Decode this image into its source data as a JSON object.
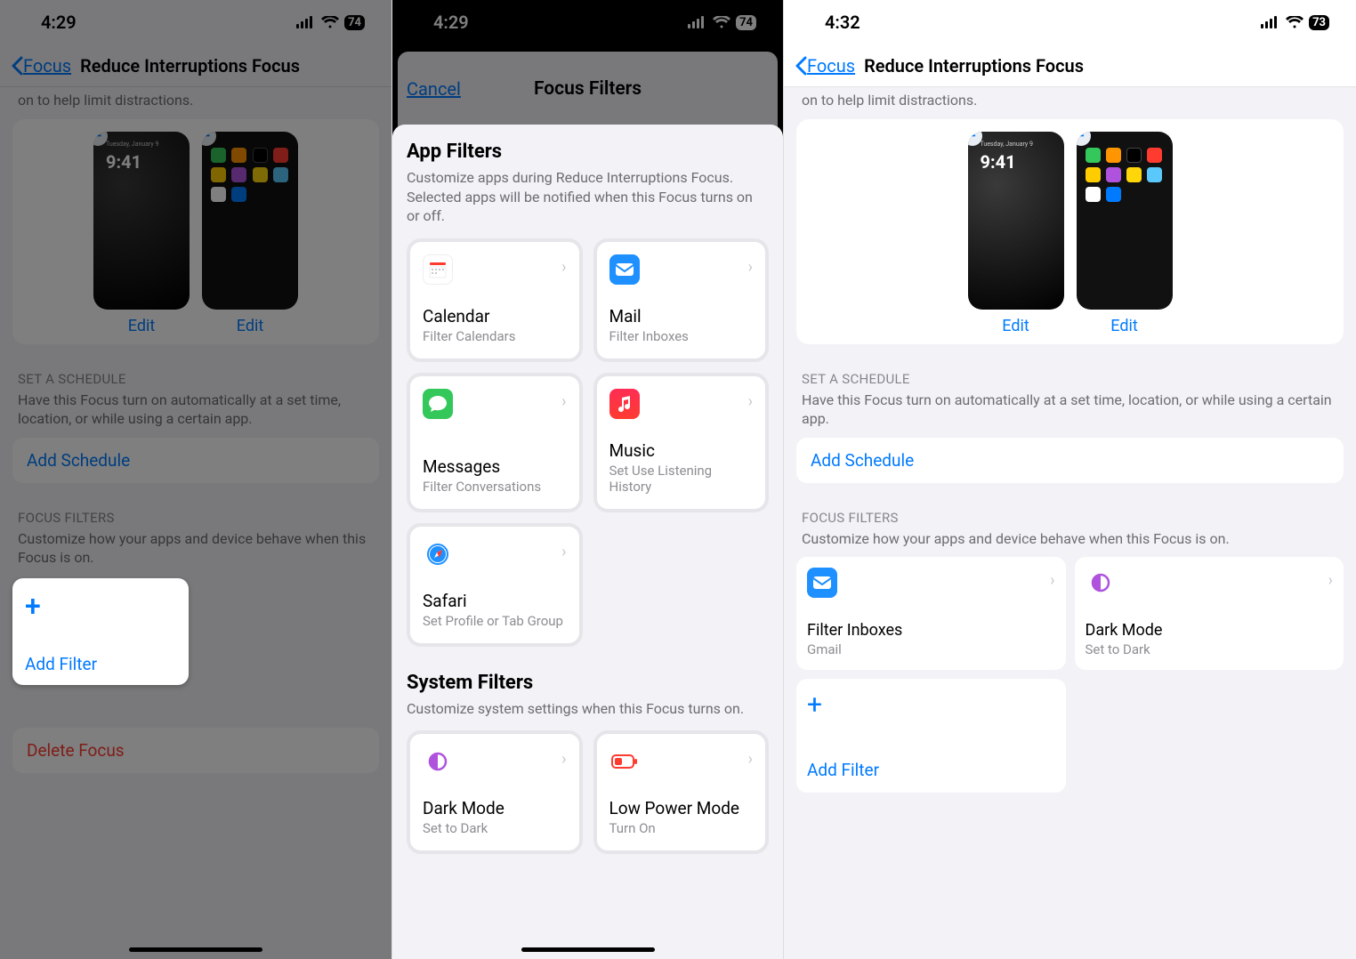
{
  "col1": {
    "status": {
      "time": "4:29",
      "battery": "74"
    },
    "nav": {
      "back": "Focus",
      "title": "Reduce Interruptions Focus"
    },
    "intro_tail": "on to help limit distractions.",
    "preview": {
      "lock_time": "9:41",
      "lock_date": "Tuesday, January 9",
      "edit": "Edit"
    },
    "schedule": {
      "title": "SET A SCHEDULE",
      "desc": "Have this Focus turn on automatically at a set time, location, or while using a certain app.",
      "button": "Add Schedule"
    },
    "filters": {
      "title": "FOCUS FILTERS",
      "desc": "Customize how your apps and device behave when this Focus is on.",
      "add": "Add Filter"
    },
    "delete": "Delete Focus"
  },
  "col2": {
    "status": {
      "time": "4:29",
      "battery": "74"
    },
    "nav": {
      "cancel": "Cancel",
      "title": "Focus Filters"
    },
    "app": {
      "title": "App Filters",
      "desc": "Customize apps during Reduce Interruptions Focus. Selected apps will be notified when this Focus turns on or off.",
      "items": [
        {
          "title": "Calendar",
          "sub": "Filter Calendars"
        },
        {
          "title": "Mail",
          "sub": "Filter Inboxes"
        },
        {
          "title": "Messages",
          "sub": "Filter Conversations"
        },
        {
          "title": "Music",
          "sub": "Set Use Listening History"
        },
        {
          "title": "Safari",
          "sub": "Set Profile or Tab Group"
        }
      ]
    },
    "system": {
      "title": "System Filters",
      "desc": "Customize system settings when this Focus turns on.",
      "items": [
        {
          "title": "Dark Mode",
          "sub": "Set to Dark"
        },
        {
          "title": "Low Power Mode",
          "sub": "Turn On"
        }
      ]
    }
  },
  "col3": {
    "status": {
      "time": "4:32",
      "battery": "73"
    },
    "nav": {
      "back": "Focus",
      "title": "Reduce Interruptions Focus"
    },
    "intro_tail": "on to help limit distractions.",
    "preview": {
      "lock_time": "9:41",
      "lock_date": "Tuesday, January 9",
      "edit": "Edit"
    },
    "schedule": {
      "title": "SET A SCHEDULE",
      "desc": "Have this Focus turn on automatically at a set time, location, or while using a certain app.",
      "button": "Add Schedule"
    },
    "filters": {
      "title": "FOCUS FILTERS",
      "desc": "Customize how your apps and device behave when this Focus is on.",
      "tiles": [
        {
          "title": "Filter Inboxes",
          "sub": "Gmail"
        },
        {
          "title": "Dark Mode",
          "sub": "Set to Dark"
        }
      ],
      "add": "Add Filter"
    }
  }
}
